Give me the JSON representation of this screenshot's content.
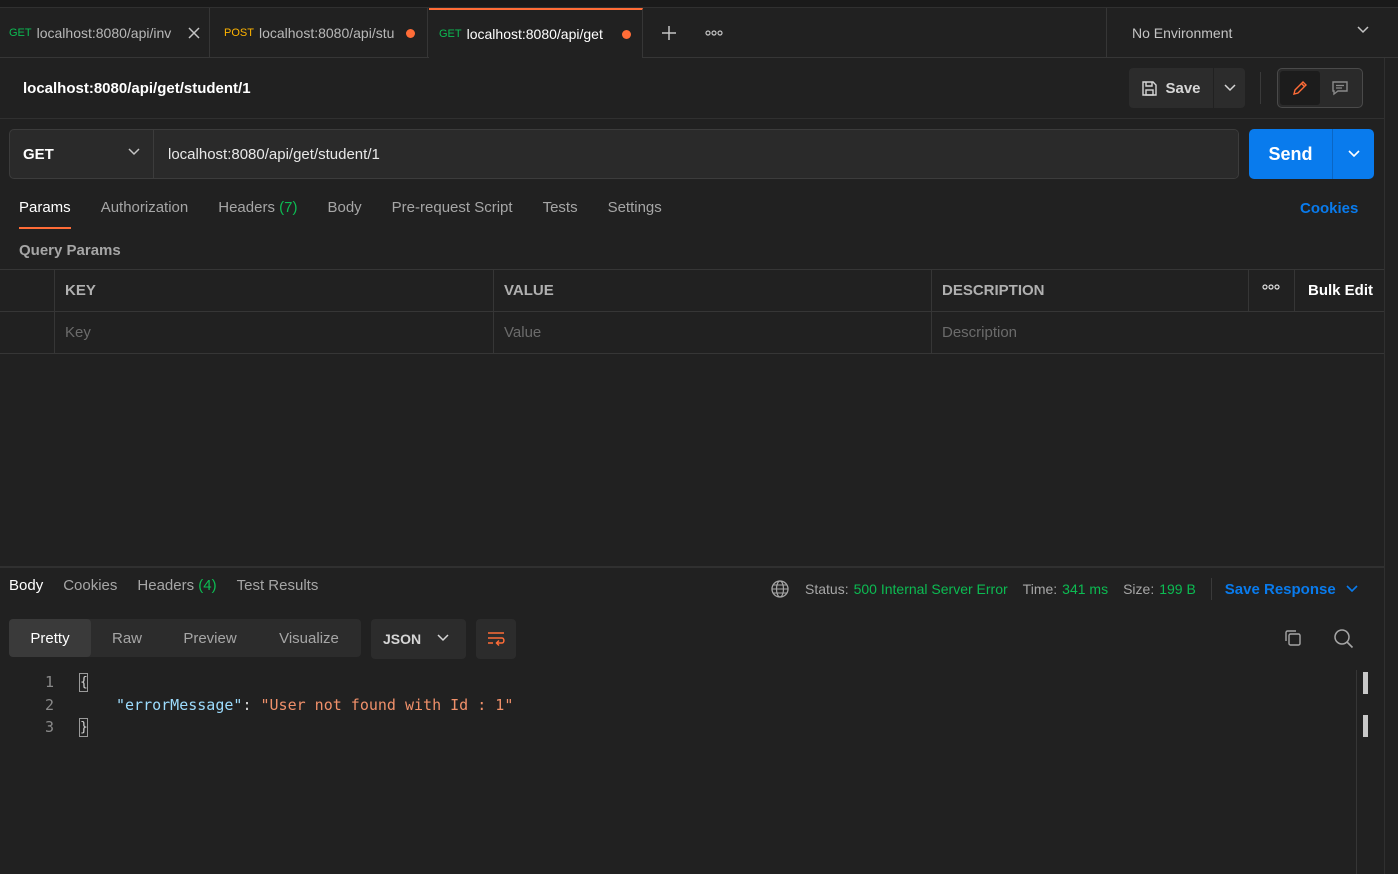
{
  "tabs": [
    {
      "method": "GET",
      "title": "localhost:8080/api/inv",
      "state": "close"
    },
    {
      "method": "POST",
      "title": "localhost:8080/api/stu",
      "state": "unsaved"
    },
    {
      "method": "GET",
      "title": "localhost:8080/api/get",
      "state": "unsaved",
      "active": true
    }
  ],
  "environment": "No Environment",
  "request": {
    "title": "localhost:8080/api/get/student/1",
    "save_label": "Save",
    "method": "GET",
    "url": "localhost:8080/api/get/student/1",
    "send_label": "Send"
  },
  "request_tabs": {
    "params": "Params",
    "authorization": "Authorization",
    "headers": "Headers",
    "headers_count": "(7)",
    "body": "Body",
    "prerequest": "Pre-request Script",
    "tests": "Tests",
    "settings": "Settings",
    "cookies": "Cookies"
  },
  "query_params": {
    "label": "Query Params",
    "columns": {
      "key": "KEY",
      "value": "VALUE",
      "description": "DESCRIPTION"
    },
    "bulk_edit": "Bulk Edit",
    "placeholders": {
      "key": "Key",
      "value": "Value",
      "description": "Description"
    }
  },
  "response": {
    "tabs": {
      "body": "Body",
      "cookies": "Cookies",
      "headers": "Headers",
      "headers_count": "(4)",
      "test_results": "Test Results"
    },
    "status_label": "Status:",
    "status_value": "500 Internal Server Error",
    "time_label": "Time:",
    "time_value": "341 ms",
    "size_label": "Size:",
    "size_value": "199 B",
    "save_response": "Save Response",
    "views": [
      "Pretty",
      "Raw",
      "Preview",
      "Visualize"
    ],
    "format": "JSON",
    "code": {
      "line_numbers": [
        "1",
        "2",
        "3"
      ],
      "open_brace": "{",
      "key": "\"errorMessage\"",
      "colon": ": ",
      "value": "\"User not found with Id : 1\"",
      "close_brace": "}"
    }
  },
  "colors": {
    "accent": "#ff6c37",
    "primary": "#097bed",
    "success": "#0cbb52",
    "post": "#ffb400"
  }
}
